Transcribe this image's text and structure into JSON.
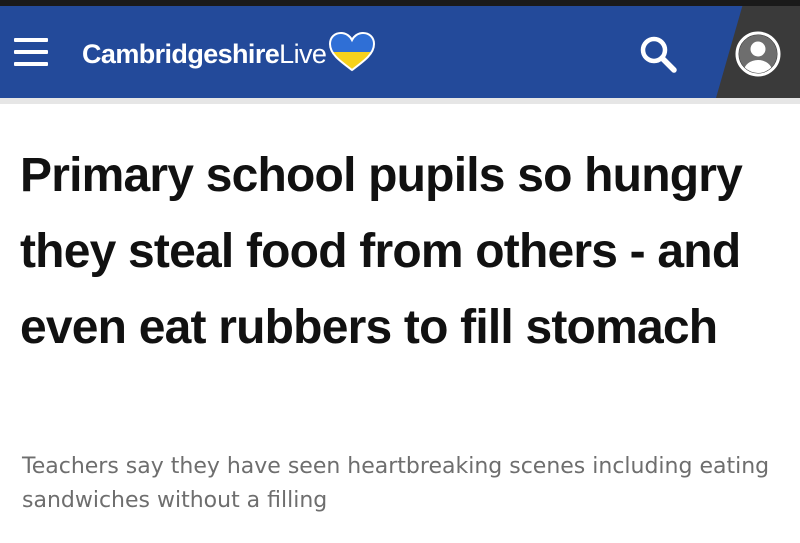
{
  "header": {
    "brand_bold": "Cambridgeshire",
    "brand_light": "Live",
    "menu_icon": "hamburger-menu-icon",
    "heart_icon": "ukraine-heart-icon",
    "search_icon": "search-icon",
    "account_icon": "account-icon"
  },
  "article": {
    "headline": "Primary school pupils so hungry they steal food from others - and even eat rubbers to fill stomach",
    "standfirst": "Teachers say they have seen heartbreaking scenes including eating sandwiches without a filling"
  },
  "colors": {
    "header_bg": "#234a9a",
    "account_bg": "#3a3a3a",
    "heart_blue": "#2f6fd6",
    "heart_yellow": "#f7d21c",
    "headline_text": "#111111",
    "standfirst_text": "#6e6e6e"
  }
}
